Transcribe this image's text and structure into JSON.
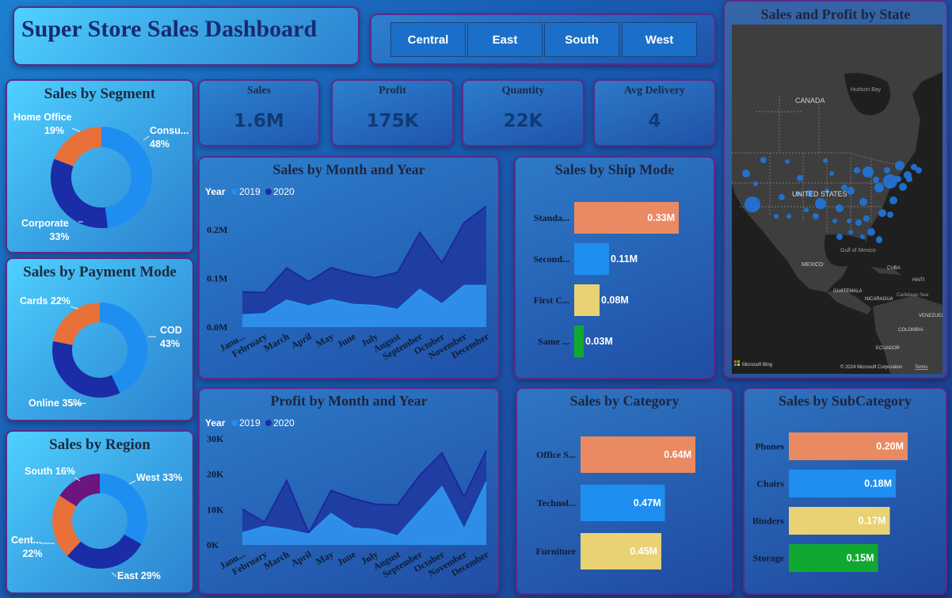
{
  "header": {
    "title": "Super Store Sales Dashboard"
  },
  "slicer": {
    "regions": [
      "Central",
      "East",
      "South",
      "West"
    ]
  },
  "kpis": [
    {
      "label": "Sales",
      "value": "1.6M"
    },
    {
      "label": "Profit",
      "value": "175K"
    },
    {
      "label": "Quantity",
      "value": "22K"
    },
    {
      "label": "Avg Delivery",
      "value": "4"
    }
  ],
  "segment": {
    "title": "Sales by Segment",
    "slices": [
      {
        "name": "Consu...",
        "pct": "48%",
        "value": 48,
        "color": "#1e8ef0"
      },
      {
        "name": "Corporate",
        "pct": "33%",
        "value": 33,
        "color": "#1a2ca6"
      },
      {
        "name": "Home Office",
        "pct": "19%",
        "value": 19,
        "color": "#e8713a"
      }
    ]
  },
  "payment": {
    "title": "Sales by Payment Mode",
    "slices": [
      {
        "name": "COD",
        "pct": "43%",
        "value": 43,
        "color": "#1e8ef0"
      },
      {
        "name": "Online",
        "pct": "35%",
        "value": 35,
        "color": "#1a2ca6"
      },
      {
        "name": "Cards",
        "pct": "22%",
        "value": 22,
        "color": "#e8713a"
      }
    ]
  },
  "region": {
    "title": "Sales by Region",
    "slices": [
      {
        "name": "West",
        "pct": "33%",
        "value": 33,
        "color": "#1e8ef0"
      },
      {
        "name": "East",
        "pct": "29%",
        "value": 29,
        "color": "#1a2ca6"
      },
      {
        "name": "Cent...",
        "pct": "22%",
        "value": 22,
        "color": "#e8713a"
      },
      {
        "name": "South",
        "pct": "16%",
        "value": 16,
        "color": "#6c1480"
      }
    ]
  },
  "sales_month": {
    "title": "Sales by Month and Year",
    "legend_title": "Year",
    "series_names": [
      "2019",
      "2020"
    ],
    "yticks": [
      "0.0M",
      "0.1M",
      "0.2M"
    ]
  },
  "profit_month": {
    "title": "Profit by Month and Year",
    "legend_title": "Year",
    "series_names": [
      "2019",
      "2020"
    ],
    "yticks": [
      "0K",
      "10K",
      "20K",
      "30K"
    ]
  },
  "months": [
    "January",
    "February",
    "March",
    "April",
    "May",
    "June",
    "July",
    "August",
    "September",
    "October",
    "November",
    "December"
  ],
  "month_ticks": [
    "Janu...",
    "February",
    "March",
    "April",
    "May",
    "June",
    "July",
    "August",
    "September",
    "October",
    "November",
    "December"
  ],
  "ship": {
    "title": "Sales by Ship Mode",
    "bars": [
      {
        "label": "Standa...",
        "value": 0.33,
        "text": "0.33M",
        "color": "#ea8a62"
      },
      {
        "label": "Second...",
        "value": 0.11,
        "text": "0.11M",
        "color": "#1e8ef0"
      },
      {
        "label": "First C...",
        "value": 0.08,
        "text": "0.08M",
        "color": "#e8d274"
      },
      {
        "label": "Same ...",
        "value": 0.03,
        "text": "0.03M",
        "color": "#11a832"
      }
    ]
  },
  "category": {
    "title": "Sales by Category",
    "bars": [
      {
        "label": "Office S...",
        "value": 0.64,
        "text": "0.64M",
        "color": "#ea8a62"
      },
      {
        "label": "Technol...",
        "value": 0.47,
        "text": "0.47M",
        "color": "#1e8ef0"
      },
      {
        "label": "Furniture",
        "value": 0.45,
        "text": "0.45M",
        "color": "#e8d274"
      }
    ]
  },
  "subcategory": {
    "title": "Sales by SubCategory",
    "bars": [
      {
        "label": "Phones",
        "value": 0.2,
        "text": "0.20M",
        "color": "#ea8a62"
      },
      {
        "label": "Chairs",
        "value": 0.18,
        "text": "0.18M",
        "color": "#1e8ef0"
      },
      {
        "label": "Binders",
        "value": 0.17,
        "text": "0.17M",
        "color": "#e8d274"
      },
      {
        "label": "Storage",
        "value": 0.15,
        "text": "0.15M",
        "color": "#11a832"
      }
    ]
  },
  "map": {
    "title": "Sales and Profit by State",
    "labels": [
      "CANADA",
      "Hudson Bay",
      "UNITED STATES",
      "MEXICO",
      "Gulf of Mexico",
      "CUBA",
      "HAITI",
      "GUATEMALA",
      "NICARAGUA",
      "Caribbean Sea",
      "VENEZUELA",
      "COLOMBIA",
      "ECUADOR"
    ],
    "brand": "Microsoft Bing",
    "copyright": "© 2024 Microsoft Corporation",
    "terms": "Terms"
  },
  "chart_data": [
    {
      "type": "area",
      "title": "Sales by Month and Year",
      "ylabel": "",
      "ylim": [
        0,
        0.25
      ],
      "categories": [
        "January",
        "February",
        "March",
        "April",
        "May",
        "June",
        "July",
        "August",
        "September",
        "October",
        "November",
        "December"
      ],
      "series": [
        {
          "name": "2019",
          "values": [
            0.025,
            0.027,
            0.055,
            0.043,
            0.056,
            0.046,
            0.044,
            0.036,
            0.077,
            0.047,
            0.085,
            0.085
          ]
        },
        {
          "name": "2020",
          "values": [
            0.072,
            0.071,
            0.121,
            0.093,
            0.122,
            0.109,
            0.101,
            0.112,
            0.194,
            0.132,
            0.214,
            0.248
          ]
        }
      ]
    },
    {
      "type": "area",
      "title": "Profit by Month and Year",
      "ylabel": "",
      "ylim": [
        0,
        30000
      ],
      "categories": [
        "January",
        "February",
        "March",
        "April",
        "May",
        "June",
        "July",
        "August",
        "September",
        "October",
        "November",
        "December"
      ],
      "series": [
        {
          "name": "2019",
          "values": [
            3400,
            5200,
            4300,
            3000,
            8800,
            4700,
            4300,
            2500,
            9500,
            16400,
            4400,
            17800
          ]
        },
        {
          "name": "2020",
          "values": [
            10100,
            6400,
            18200,
            3300,
            15400,
            13100,
            11500,
            11300,
            19700,
            26000,
            13600,
            26700
          ]
        }
      ]
    },
    {
      "type": "bar",
      "title": "Sales by Ship Mode",
      "categories": [
        "Standa...",
        "Second...",
        "First C...",
        "Same ..."
      ],
      "values": [
        0.33,
        0.11,
        0.08,
        0.03
      ]
    },
    {
      "type": "bar",
      "title": "Sales by Category",
      "categories": [
        "Office S...",
        "Technol...",
        "Furniture"
      ],
      "values": [
        0.64,
        0.47,
        0.45
      ]
    },
    {
      "type": "bar",
      "title": "Sales by SubCategory",
      "categories": [
        "Phones",
        "Chairs",
        "Binders",
        "Storage"
      ],
      "values": [
        0.2,
        0.18,
        0.17,
        0.15
      ]
    },
    {
      "type": "pie",
      "title": "Sales by Segment",
      "categories": [
        "Consu...",
        "Corporate",
        "Home Office"
      ],
      "values": [
        48,
        33,
        19
      ]
    },
    {
      "type": "pie",
      "title": "Sales by Payment Mode",
      "categories": [
        "COD",
        "Online",
        "Cards"
      ],
      "values": [
        43,
        35,
        22
      ]
    },
    {
      "type": "pie",
      "title": "Sales by Region",
      "categories": [
        "West",
        "East",
        "Cent...",
        "South"
      ],
      "values": [
        33,
        29,
        22,
        16
      ]
    }
  ]
}
